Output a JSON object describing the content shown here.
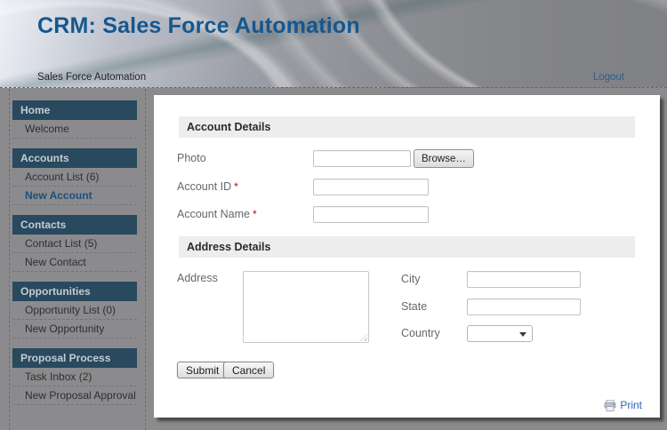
{
  "header": {
    "title": "CRM: Sales Force Automation",
    "menubar": {
      "app": "Sales Force Automation",
      "logout": "Logout"
    }
  },
  "sidebar": {
    "sections": [
      {
        "label": "Home",
        "items": [
          {
            "label": "Welcome"
          }
        ]
      },
      {
        "label": "Accounts",
        "items": [
          {
            "label": "Account List (6)"
          },
          {
            "label": "New Account"
          }
        ]
      },
      {
        "label": "Contacts",
        "items": [
          {
            "label": "Contact List (5)"
          },
          {
            "label": "New Contact"
          }
        ]
      },
      {
        "label": "Opportunities",
        "items": [
          {
            "label": "Opportunity List (0)"
          },
          {
            "label": "New Opportunity"
          }
        ]
      },
      {
        "label": "Proposal Process",
        "items": [
          {
            "label": "Task Inbox (2)"
          },
          {
            "label": "New Proposal Approval"
          }
        ]
      }
    ],
    "active_item": "New Account"
  },
  "form": {
    "required_marker": "*",
    "account_section": {
      "title": "Account Details"
    },
    "photo": {
      "label": "Photo",
      "browse_label": "Browse…",
      "value": ""
    },
    "account_id": {
      "label": "Account ID",
      "required": true,
      "value": ""
    },
    "account_name": {
      "label": "Account Name",
      "required": true,
      "value": ""
    },
    "address_section": {
      "title": "Address Details"
    },
    "address": {
      "label": "Address",
      "value": ""
    },
    "city": {
      "label": "City",
      "value": ""
    },
    "state": {
      "label": "State",
      "value": ""
    },
    "country": {
      "label": "Country",
      "selected_value": ""
    },
    "actions": {
      "submit": "Submit",
      "cancel": "Cancel"
    }
  },
  "footer": {
    "print": "Print"
  },
  "colors": {
    "title_blue": "#15578f",
    "nav_header_bg": "#28495e",
    "active_link_blue": "#1d4f7c",
    "logout_link_blue": "#2d5e8d",
    "required_red": "#cc0000",
    "section_bar_bg": "#ededee",
    "page_bg": "#8b8b8d"
  }
}
